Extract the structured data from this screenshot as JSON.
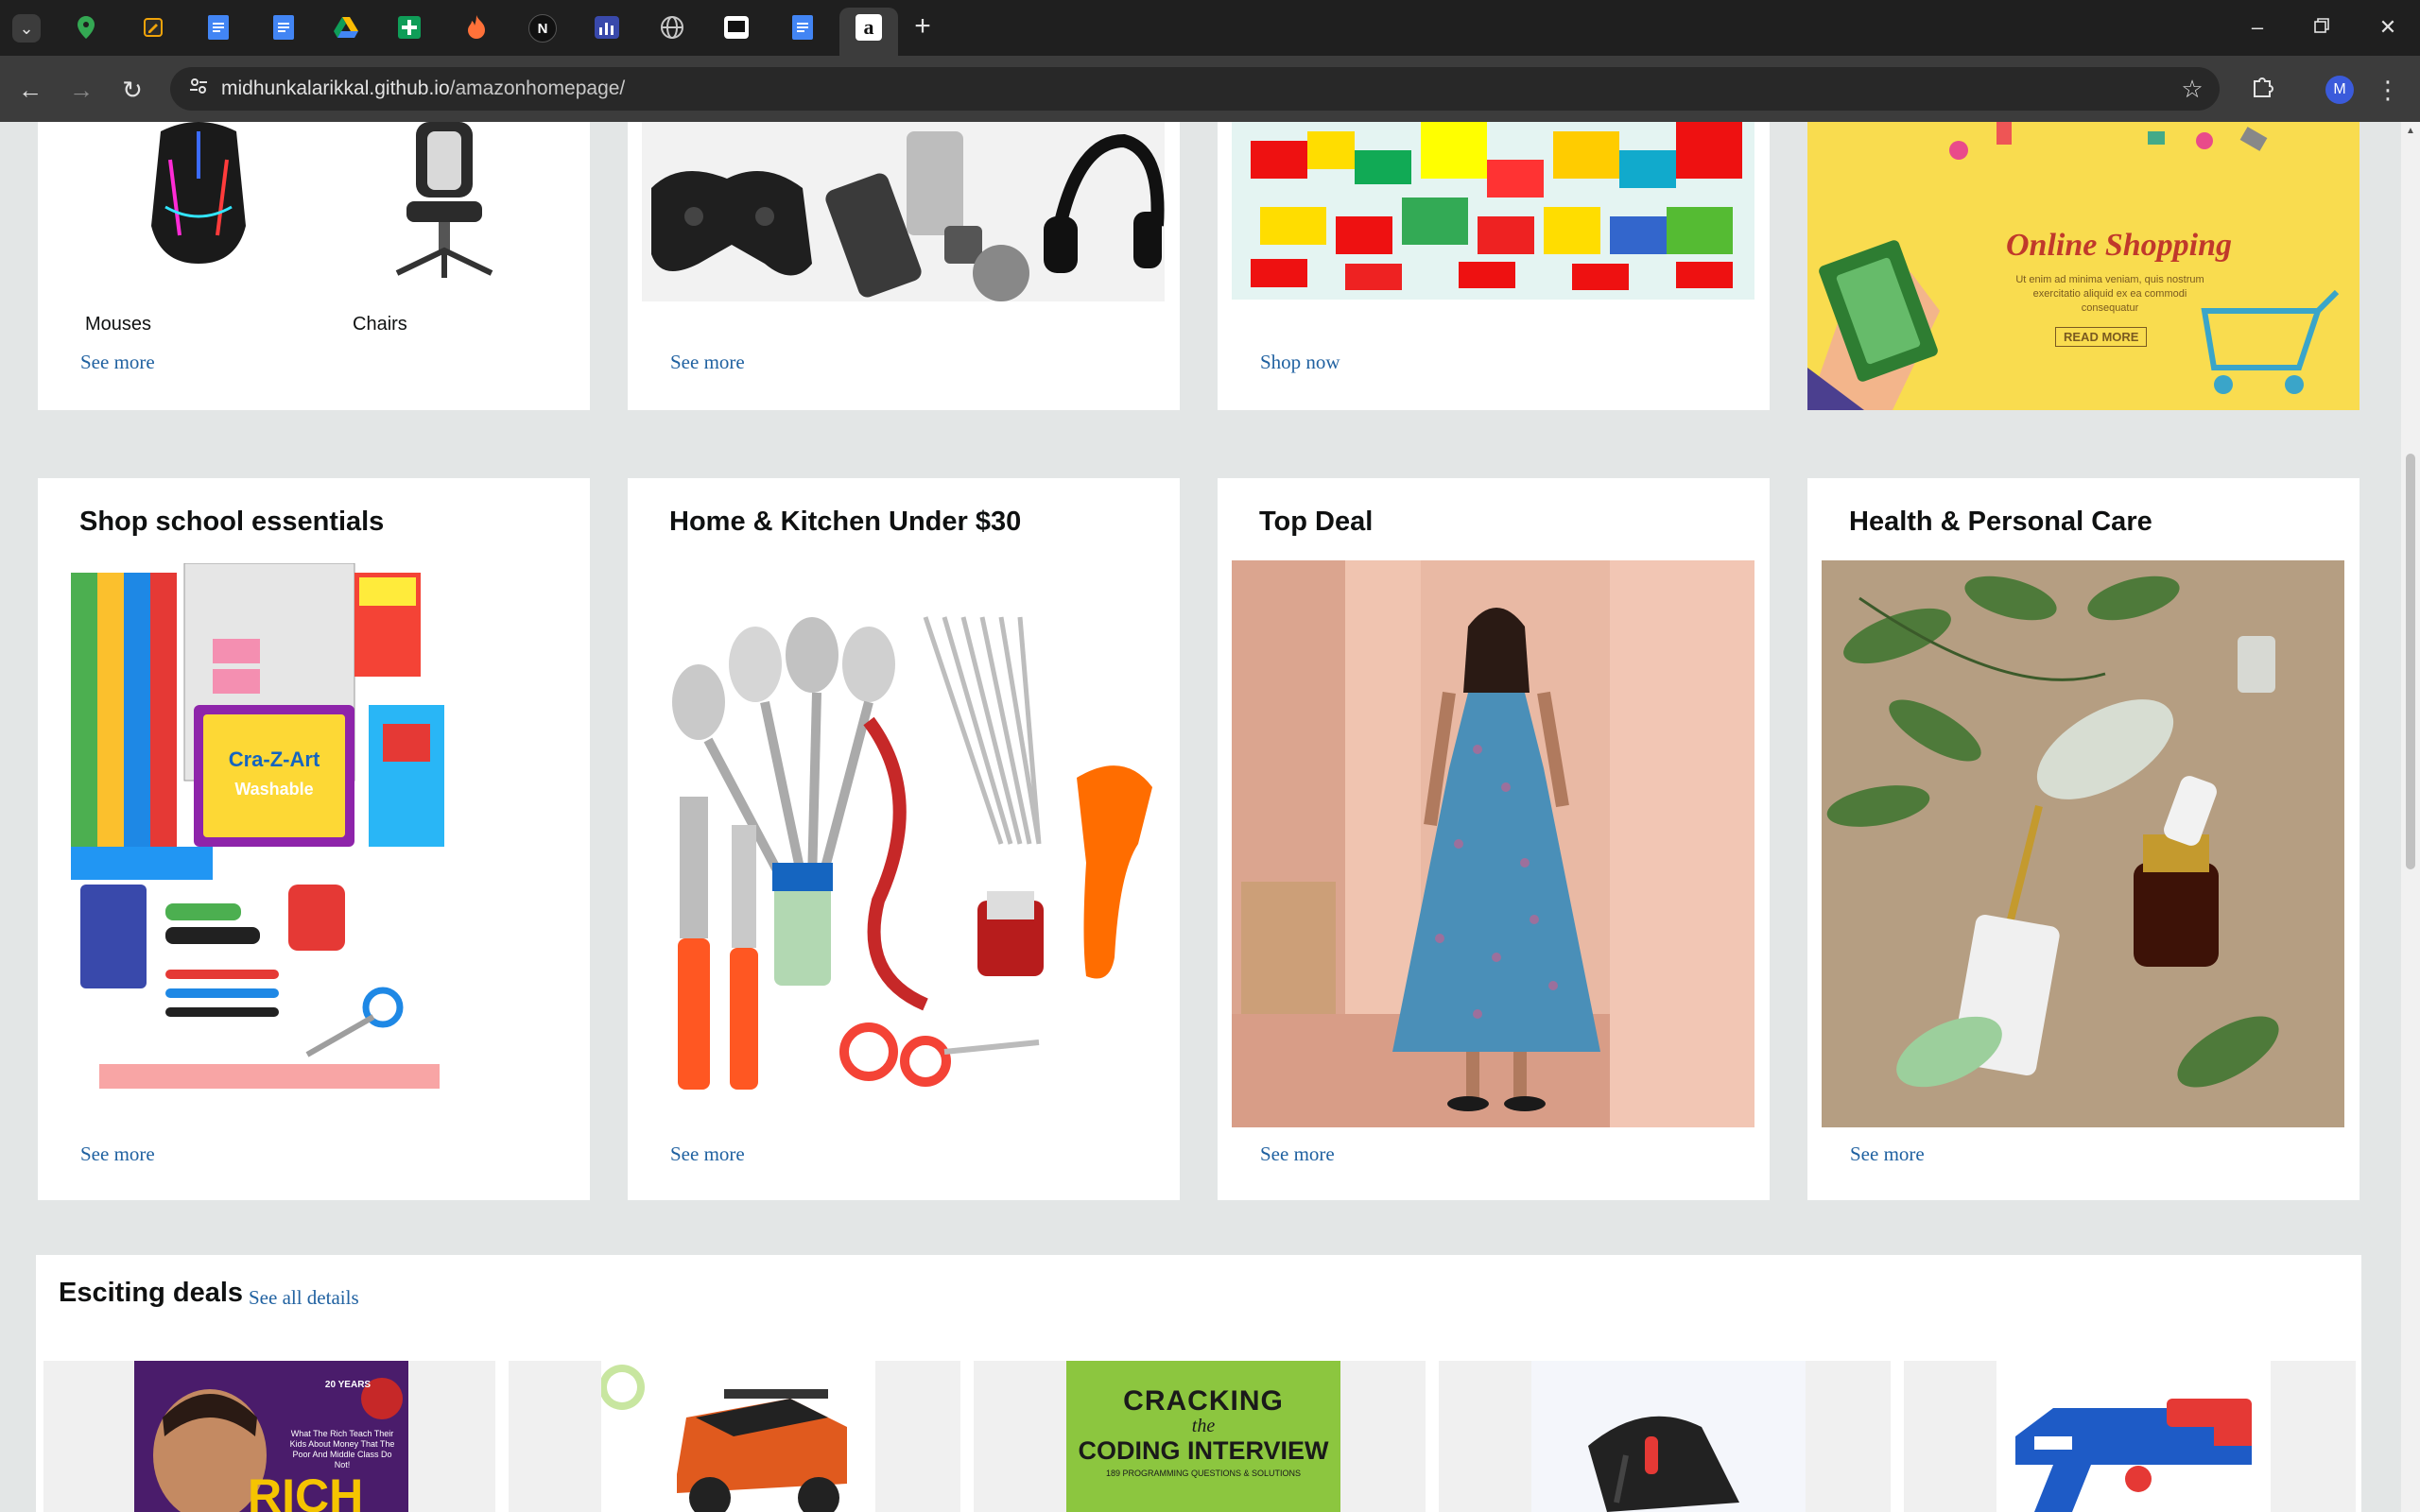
{
  "browser": {
    "tabs": [
      {
        "icon": "maps-pin-icon",
        "color": "#34a853"
      },
      {
        "icon": "pencil-app-icon",
        "color": "#f0a30a"
      },
      {
        "icon": "docs-icon",
        "color": "#4285f4"
      },
      {
        "icon": "docs-icon",
        "color": "#4285f4"
      },
      {
        "icon": "drive-icon",
        "color": "#fbbc04"
      },
      {
        "icon": "sheets-plus-icon",
        "color": "#0f9d58"
      },
      {
        "icon": "flame-icon",
        "color": "#ff7139"
      },
      {
        "icon": "notion-icon",
        "color": "#ffffff"
      },
      {
        "icon": "chart-app-icon",
        "color": "#5c6bc0"
      },
      {
        "icon": "globe-icon",
        "color": "#9aa0a6"
      },
      {
        "icon": "monitor-icon",
        "color": "#ffffff"
      },
      {
        "icon": "docs-icon",
        "color": "#4285f4"
      },
      {
        "icon": "amazon-icon",
        "color": "#ffffff",
        "active": true
      }
    ],
    "url_host": "midhunkalarikkal.github.io",
    "url_path": "/amazonhomepage/",
    "avatar_letter": "M"
  },
  "top_row": {
    "card1": {
      "labels": [
        "Mouses",
        "Chairs"
      ],
      "link": "See more"
    },
    "card2": {
      "link": "See more"
    },
    "card3": {
      "link": "Shop now"
    },
    "card4": {
      "banner_title": "Online Shopping",
      "banner_text": "Ut enim ad minima veniam, quis nostrum exercitatio aliquid ex ea commodi consequatur",
      "banner_button": "READ MORE"
    }
  },
  "middle_row": [
    {
      "title": "Shop school essentials",
      "link": "See more"
    },
    {
      "title": "Home & Kitchen Under $30",
      "link": "See more"
    },
    {
      "title": "Top Deal",
      "link": "See more"
    },
    {
      "title": "Health & Personal Care",
      "link": "See more"
    }
  ],
  "deals": {
    "title": "Esciting deals",
    "link": "See all details",
    "items": [
      {
        "book_tag": "20 YEARS",
        "book_text": "What The Rich Teach Their Kids About Money That The Poor And Middle Class Do Not!",
        "book_title": "RICH"
      },
      {
        "name": "toy-jeep"
      },
      {
        "book_title_1": "CRACKING",
        "book_title_2": "the",
        "book_title_3": "CODING INTERVIEW",
        "book_subtitle": "189 PROGRAMMING QUESTIONS & SOLUTIONS"
      },
      {
        "name": "gaming-mouse"
      },
      {
        "name": "toy-blaster"
      }
    ]
  }
}
